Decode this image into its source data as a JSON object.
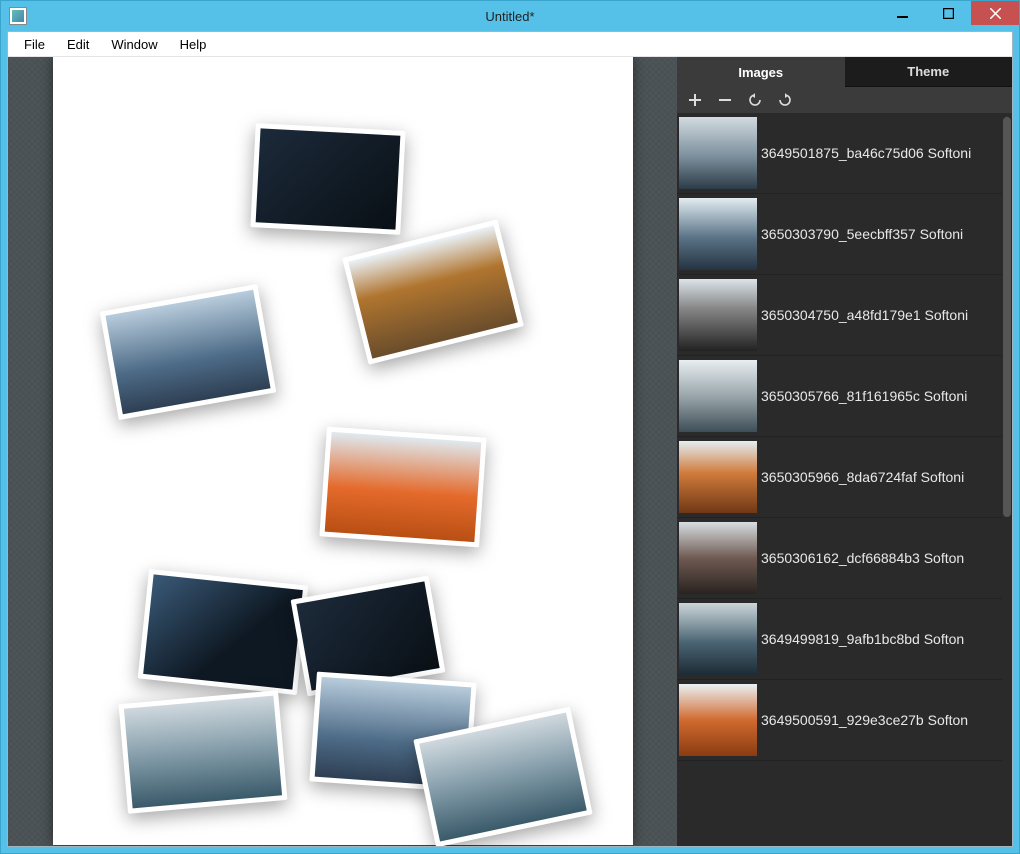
{
  "window": {
    "title": "Untitled*"
  },
  "menu": {
    "file": "File",
    "edit": "Edit",
    "window": "Window",
    "help": "Help"
  },
  "tabs": {
    "images": "Images",
    "theme": "Theme"
  },
  "images": [
    {
      "label": "3649501875_ba46c75d06 Softoni"
    },
    {
      "label": "3650303790_5eecbff357 Softoni"
    },
    {
      "label": "3650304750_a48fd179e1 Softoni"
    },
    {
      "label": "3650305766_81f161965c Softoni"
    },
    {
      "label": "3650305966_8da6724faf Softoni"
    },
    {
      "label": "3650306162_dcf66884b3 Softon"
    },
    {
      "label": "3649499819_9afb1bc8bd Softon"
    },
    {
      "label": "3649500591_929e3ce27b Softon"
    }
  ]
}
